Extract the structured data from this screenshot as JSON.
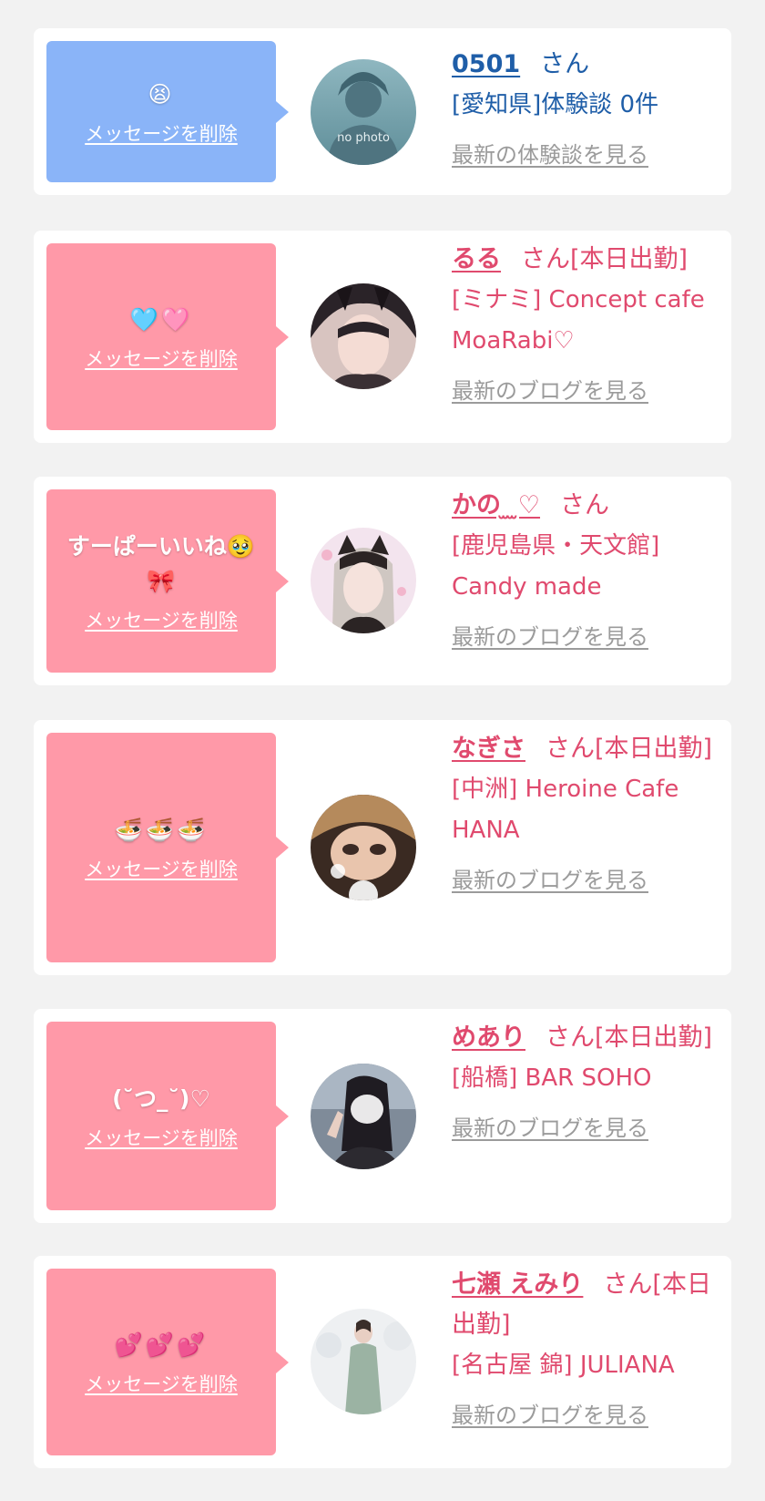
{
  "delete_label": "メッセージを削除",
  "colors": {
    "blue_bubble": "#8ab4f8",
    "pink_bubble": "#ff99a8",
    "blue_text": "#1f5ea8",
    "pink_text": "#e04a6e",
    "link_gray": "#9b9b9b"
  },
  "items": [
    {
      "message": "😫",
      "name": "0501",
      "honorific": "さん",
      "status": "",
      "location": "[愛知県]体験談 0件",
      "link": "最新の体験談を見る",
      "avatar_icon": "no-photo-icon",
      "avatar_text": "no photo"
    },
    {
      "message": "🩵🩷",
      "name": "るる",
      "honorific": "さん[本日出勤]",
      "location": "[ミナミ] Concept cafe MoaRabi♡",
      "link": "最新のブログを見る",
      "avatar_icon": "profile-photo"
    },
    {
      "message": "すーぱーいいね🥹🎀",
      "name": "かの ̫ ̫♡",
      "honorific": "さん",
      "location": "[鹿児島県・天文館] Candy made",
      "link": "最新のブログを見る",
      "avatar_icon": "profile-photo"
    },
    {
      "message": "🍜🍜🍜",
      "name": "なぎさ",
      "honorific": "さん[本日出勤]",
      "location": "[中洲] Heroine Cafe HANA",
      "link": "最新のブログを見る",
      "avatar_icon": "profile-photo"
    },
    {
      "message": "(˘つ_˘)♡",
      "name": "めあり",
      "honorific": "さん[本日出勤]",
      "location": "[船橋] BAR SOHO",
      "link": "最新のブログを見る",
      "avatar_icon": "profile-photo"
    },
    {
      "message": "💕💕💕",
      "name": "七瀬 えみり",
      "honorific": "さん[本日出勤]",
      "location": "[名古屋 錦] JULIANA",
      "link": "最新のブログを見る",
      "avatar_icon": "profile-photo"
    }
  ]
}
